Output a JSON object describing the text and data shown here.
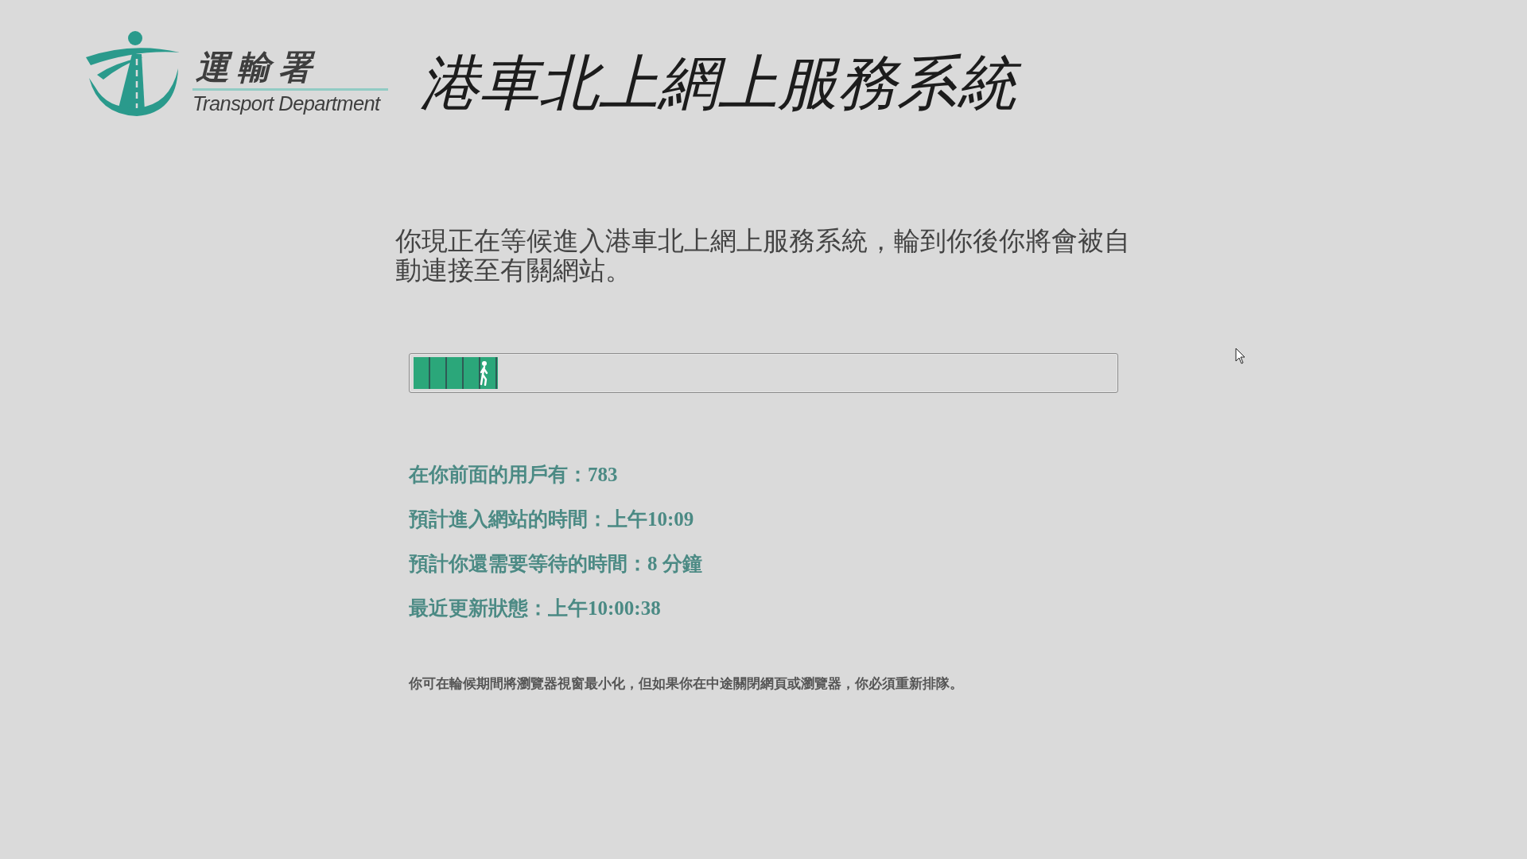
{
  "header": {
    "logo": {
      "name_zh": "運輸署",
      "name_en": "Transport Department"
    },
    "title": "港車北上網上服務系統"
  },
  "queue": {
    "message": "你現正在等候進入港車北上網上服務系統，輪到你後你將會被自動連接至有關網站。",
    "progress": {
      "level": 0.12
    },
    "details": [
      "在你前面的用戶有：783",
      "預計進入網站的時間：上午10:09",
      "預計你還需要等待的時間：8 分鐘",
      "最近更新狀態：上午10:00:38"
    ],
    "note": "你可在輪候期間將瀏覽器視窗最小化，但如果你在中途關閉網頁或瀏覽器，你必須重新排隊。"
  }
}
